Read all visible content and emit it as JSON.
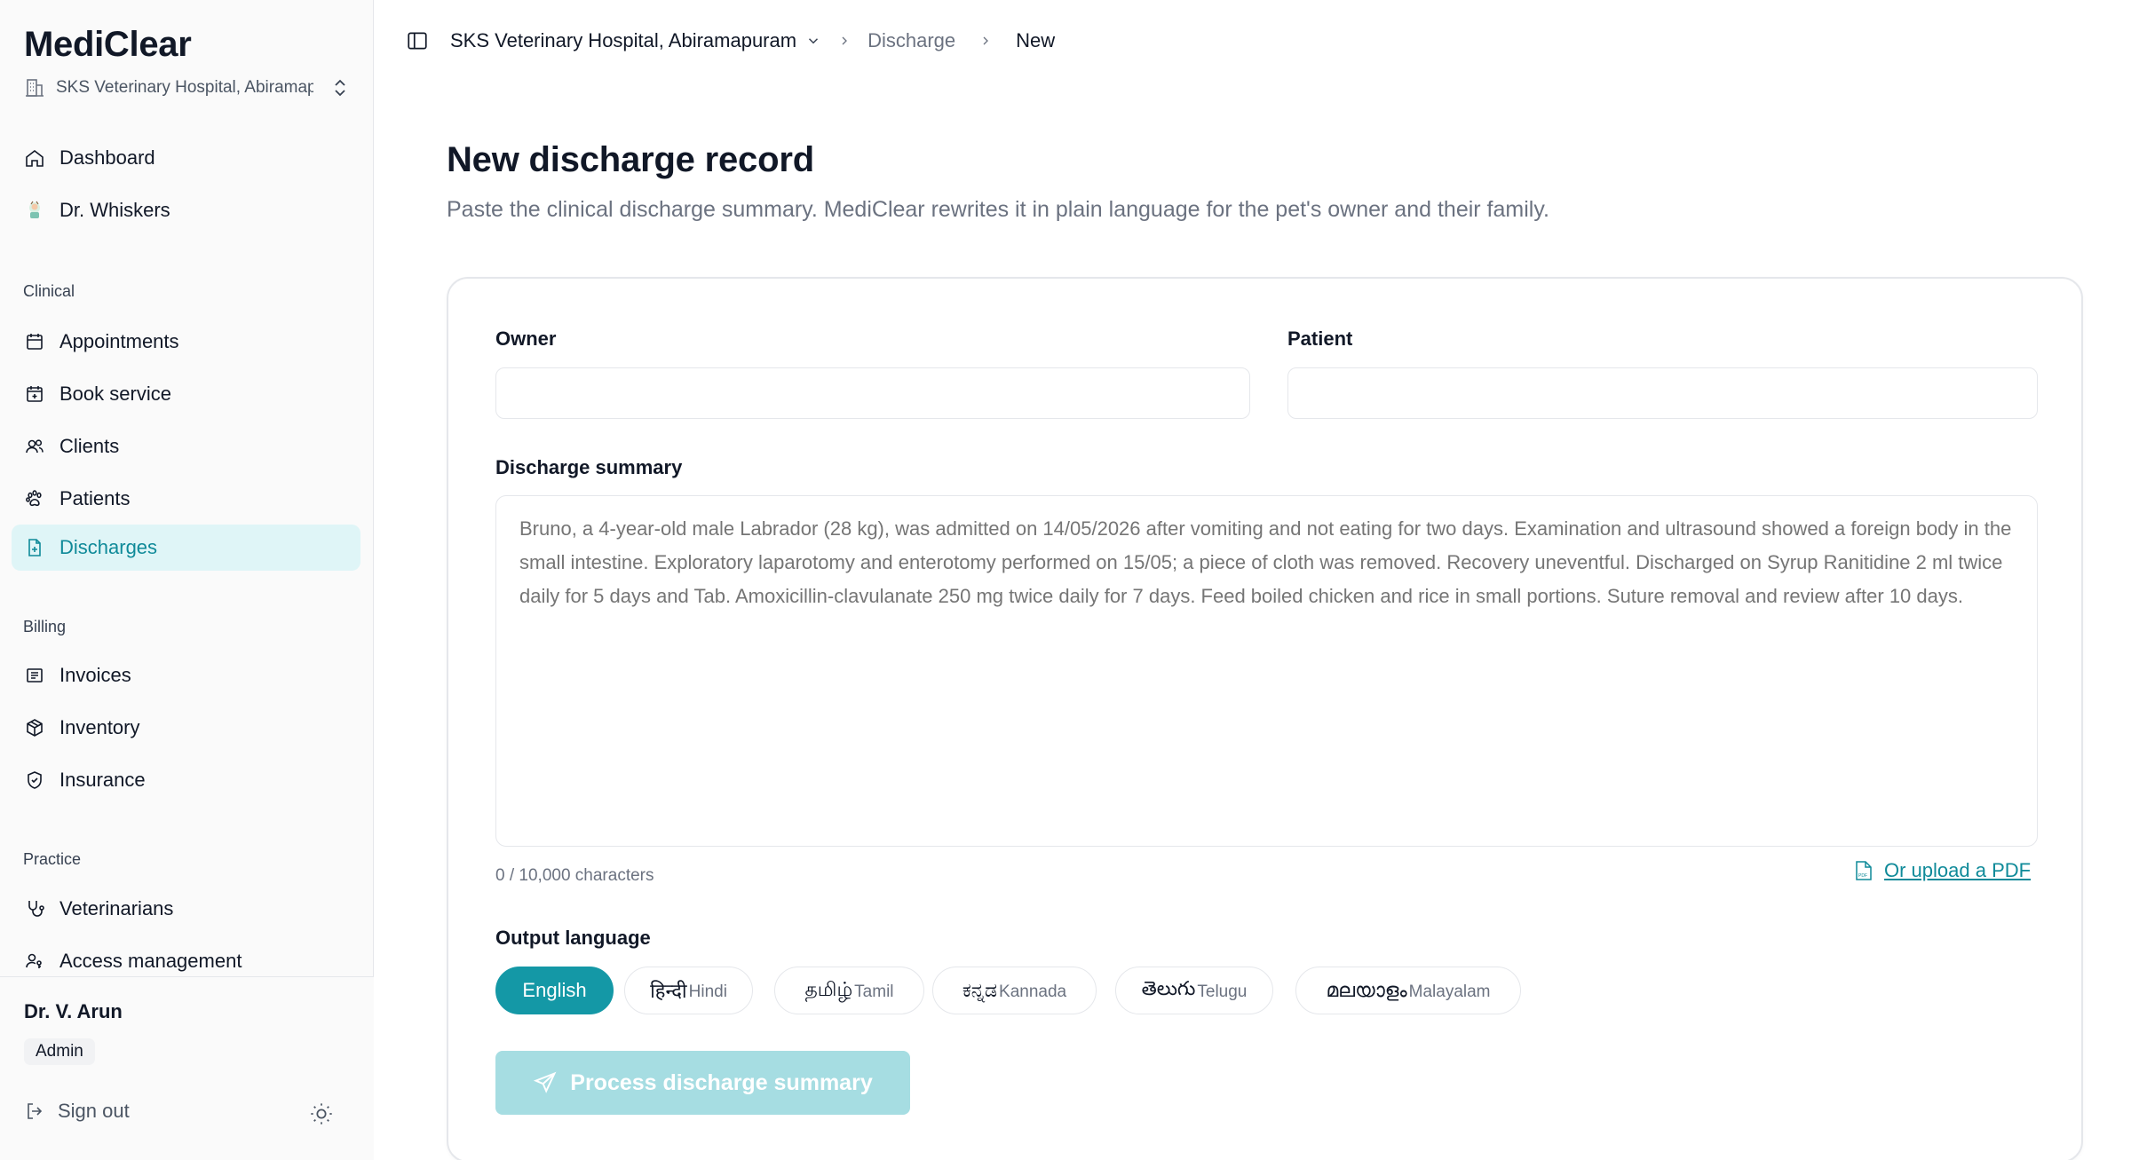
{
  "sidebar": {
    "brand": "MediClear",
    "clinic": "SKS Veterinary Hospital, Abiramapuram",
    "nav_top": [
      {
        "label": "Dashboard",
        "icon": "home-icon"
      },
      {
        "label": "Dr. Whiskers",
        "icon": "whiskers-avatar-icon"
      }
    ],
    "sections": {
      "clinical": "Clinical",
      "billing": "Billing",
      "practice": "Practice"
    },
    "clinical_items": [
      {
        "label": "Appointments",
        "icon": "calendar-icon"
      },
      {
        "label": "Book service",
        "icon": "calendar-plus-icon"
      },
      {
        "label": "Clients",
        "icon": "users-icon"
      },
      {
        "label": "Patients",
        "icon": "paw-icon"
      },
      {
        "label": "Discharges",
        "icon": "file-plus-icon",
        "active": true
      }
    ],
    "billing_items": [
      {
        "label": "Invoices",
        "icon": "receipt-icon"
      },
      {
        "label": "Inventory",
        "icon": "box-icon"
      },
      {
        "label": "Insurance",
        "icon": "shield-icon"
      }
    ],
    "practice_items": [
      {
        "label": "Veterinarians",
        "icon": "stethoscope-icon"
      },
      {
        "label": "Access management",
        "icon": "user-key-icon"
      }
    ],
    "footer": {
      "user_name": "Dr. V. Arun",
      "role": "Admin",
      "sign_out": "Sign out"
    }
  },
  "topbar": {
    "clinic": "SKS Veterinary Hospital, Abiramapuram",
    "crumb_discharge": "Discharge",
    "crumb_new": "New"
  },
  "page": {
    "title": "New discharge record",
    "subtitle": "Paste the clinical discharge summary. MediClear rewrites it in plain language for the pet's owner and their family."
  },
  "form": {
    "owner_label": "Owner",
    "owner_value": "",
    "patient_label": "Patient",
    "patient_value": "",
    "summary_label": "Discharge summary",
    "summary_placeholder": "Bruno, a 4-year-old male Labrador (28 kg), was admitted on 14/05/2026 after vomiting and not eating for two days. Examination and ultrasound showed a foreign body in the small intestine. Exploratory laparotomy and enterotomy performed on 15/05; a piece of cloth was removed. Recovery uneventful. Discharged on Syrup Ranitidine 2 ml twice daily for 5 days and Tab. Amoxicillin-clavulanate 250 mg twice daily for 7 days. Feed boiled chicken and rice in small portions. Suture removal and review after 10 days.",
    "char_count": "0 / 10,000 characters",
    "upload_link": "Or upload a PDF",
    "language_label": "Output language",
    "languages": [
      {
        "native": "English",
        "english": ""
      },
      {
        "native": "हिन्दी",
        "english": "Hindi"
      },
      {
        "native": "தமிழ்",
        "english": "Tamil"
      },
      {
        "native": "ಕನ್ನಡ",
        "english": "Kannada"
      },
      {
        "native": "తెలుగు",
        "english": "Telugu"
      },
      {
        "native": "മലയാളം",
        "english": "Malayalam"
      }
    ],
    "selected_language": "English",
    "process_button": "Process discharge summary"
  },
  "colors": {
    "accent": "#1498a6",
    "accent_light": "#dff5f7",
    "button_disabled": "#a6dde2"
  }
}
